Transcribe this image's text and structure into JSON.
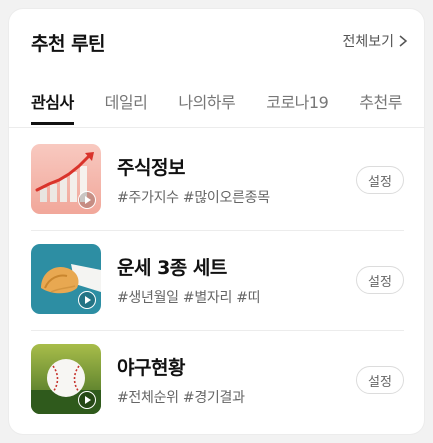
{
  "header": {
    "title": "추천 루틴",
    "see_all_label": "전체보기"
  },
  "tabs": [
    {
      "label": "관심사",
      "active": true
    },
    {
      "label": "데일리",
      "active": false
    },
    {
      "label": "나의하루",
      "active": false
    },
    {
      "label": "코로나19",
      "active": false
    },
    {
      "label": "추천루",
      "active": false
    }
  ],
  "routines": [
    {
      "title": "주식정보",
      "tags": "#주가지수 #많이오른종목",
      "button": "설정",
      "thumbnail": "stock-chart-image"
    },
    {
      "title": "운세 3종 세트",
      "tags": "#생년월일 #별자리 #띠",
      "button": "설정",
      "thumbnail": "fortune-cookie-image"
    },
    {
      "title": "야구현황",
      "tags": "#전체순위 #경기결과",
      "button": "설정",
      "thumbnail": "baseball-image"
    }
  ]
}
